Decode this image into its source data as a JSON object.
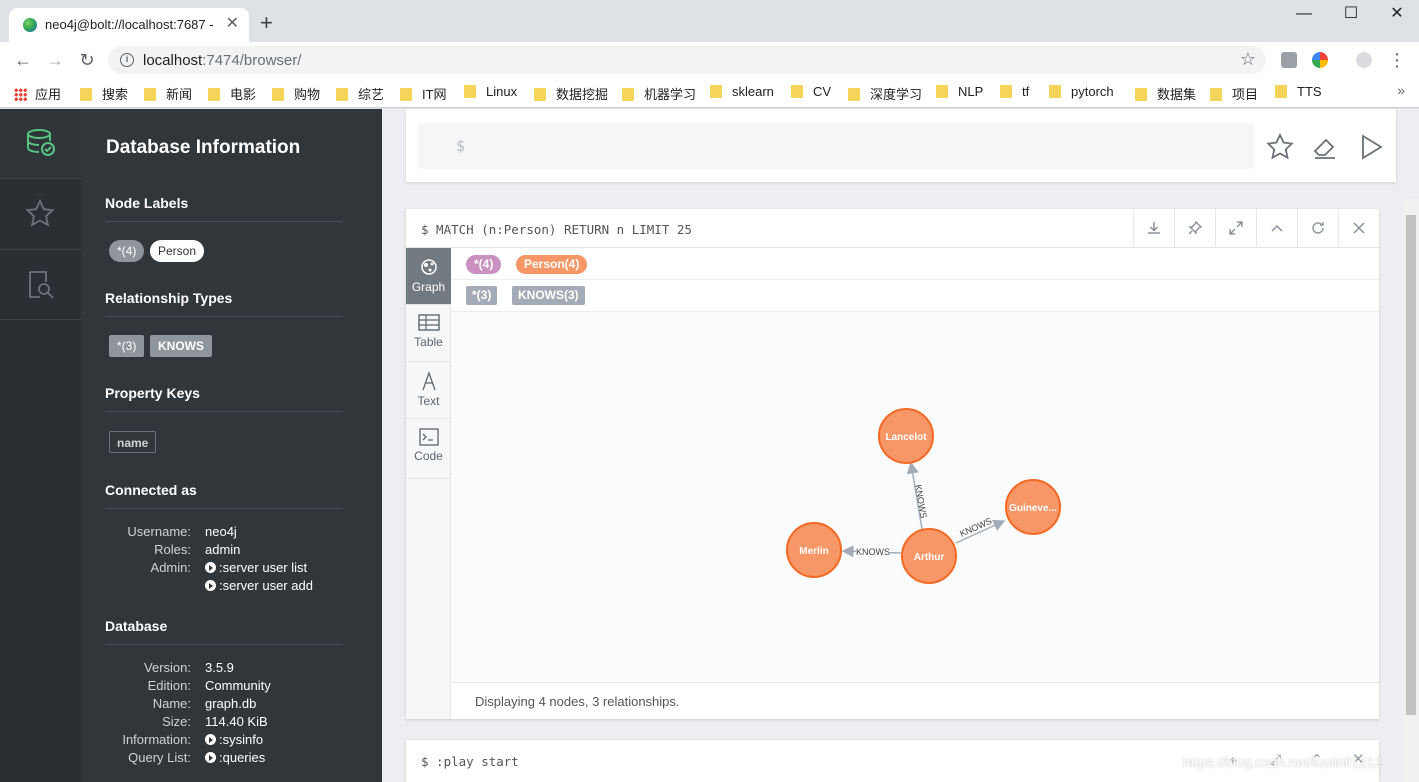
{
  "browser": {
    "tab_title": "neo4j@bolt://localhost:7687 -",
    "url_host": "localhost",
    "url_path": ":7474/browser/",
    "bookmarks": [
      "应用",
      "搜索",
      "新闻",
      "电影",
      "购物",
      "综艺",
      "IT网",
      "Linux",
      "数据挖掘",
      "机器学习",
      "sklearn",
      "CV",
      "深度学习",
      "NLP",
      "tf",
      "pytorch",
      "数据集",
      "项目",
      "TTS"
    ]
  },
  "drawer": {
    "title": "Database Information",
    "node_labels_heading": "Node Labels",
    "node_labels": [
      "*(4)",
      "Person"
    ],
    "rel_types_heading": "Relationship Types",
    "rel_types": [
      "*(3)",
      "KNOWS"
    ],
    "property_keys_heading": "Property Keys",
    "property_keys": [
      "name"
    ],
    "connected_heading": "Connected as",
    "username_label": "Username:",
    "username": "neo4j",
    "roles_label": "Roles:",
    "roles": "admin",
    "admin_label": "Admin:",
    "admin_cmd1": ":server user list",
    "admin_cmd2": ":server user add",
    "database_heading": "Database",
    "version_label": "Version:",
    "version": "3.5.9",
    "edition_label": "Edition:",
    "edition": "Community",
    "name_label": "Name:",
    "name": "graph.db",
    "size_label": "Size:",
    "size": "114.40 KiB",
    "information_label": "Information:",
    "information_cmd": ":sysinfo",
    "querylist_label": "Query List:",
    "querylist_cmd": ":queries"
  },
  "editor": {
    "prompt": "$"
  },
  "frame": {
    "query": "$ MATCH (n:Person) RETURN n LIMIT 25",
    "tabs": [
      "Graph",
      "Table",
      "Text",
      "Code"
    ],
    "legend_nodes": [
      "*(4)",
      "Person(4)"
    ],
    "legend_rels": [
      "*(3)",
      "KNOWS(3)"
    ],
    "footer": "Displaying 4 nodes, 3 relationships."
  },
  "graph": {
    "node_color": "#f79767",
    "node_border": "#f36924",
    "nodes": [
      {
        "id": "lancelot",
        "label": "Lancelot"
      },
      {
        "id": "guinevere",
        "label": "Guineve..."
      },
      {
        "id": "merlin",
        "label": "Merlin"
      },
      {
        "id": "arthur",
        "label": "Arthur"
      }
    ],
    "relationships": [
      {
        "from": "arthur",
        "to": "lancelot",
        "type": "KNOWS"
      },
      {
        "from": "arthur",
        "to": "guinevere",
        "type": "KNOWS"
      },
      {
        "from": "arthur",
        "to": "merlin",
        "type": "KNOWS"
      }
    ]
  },
  "frame2": {
    "query": "$ :play start"
  },
  "watermark": "https://blog.csdn.net/luolinll1212",
  "colors": {
    "person": "#f79767",
    "all_nodes": "#c990c0",
    "rel": "#a5abb6"
  }
}
